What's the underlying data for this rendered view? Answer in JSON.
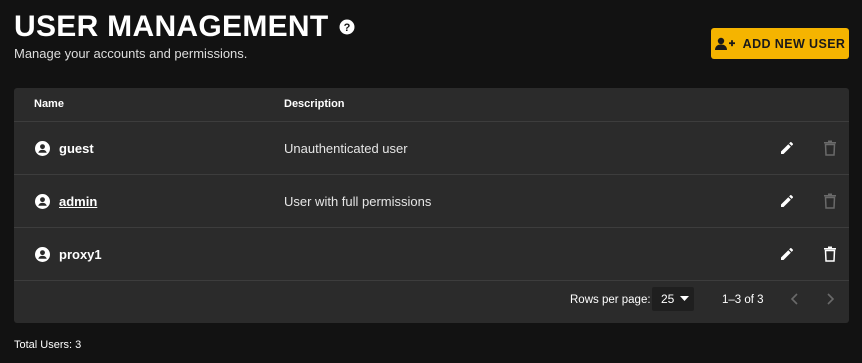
{
  "header": {
    "title": "USER MANAGEMENT",
    "subtitle": "Manage your accounts and permissions."
  },
  "actions": {
    "add_user_label": "ADD NEW USER"
  },
  "table": {
    "columns": [
      "Name",
      "Description"
    ],
    "rows": [
      {
        "name": "guest",
        "description": "Unauthenticated user",
        "name_is_link": false,
        "delete_enabled": false
      },
      {
        "name": "admin",
        "description": "User with full permissions",
        "name_is_link": true,
        "delete_enabled": false
      },
      {
        "name": "proxy1",
        "description": "",
        "name_is_link": false,
        "delete_enabled": true
      }
    ]
  },
  "pagination": {
    "rows_per_page_label": "Rows per page:",
    "rows_per_page_value": "25",
    "range_label": "1–3 of 3"
  },
  "footer": {
    "total_users": "Total Users: 3"
  },
  "colors": {
    "accent": "#f5b400",
    "background": "#121212",
    "card": "#2b2b2b"
  },
  "icons": [
    "help-icon",
    "add-user-icon",
    "user-icon",
    "edit-icon",
    "delete-icon",
    "chevron-down-icon",
    "chevron-left-icon",
    "chevron-right-icon"
  ]
}
